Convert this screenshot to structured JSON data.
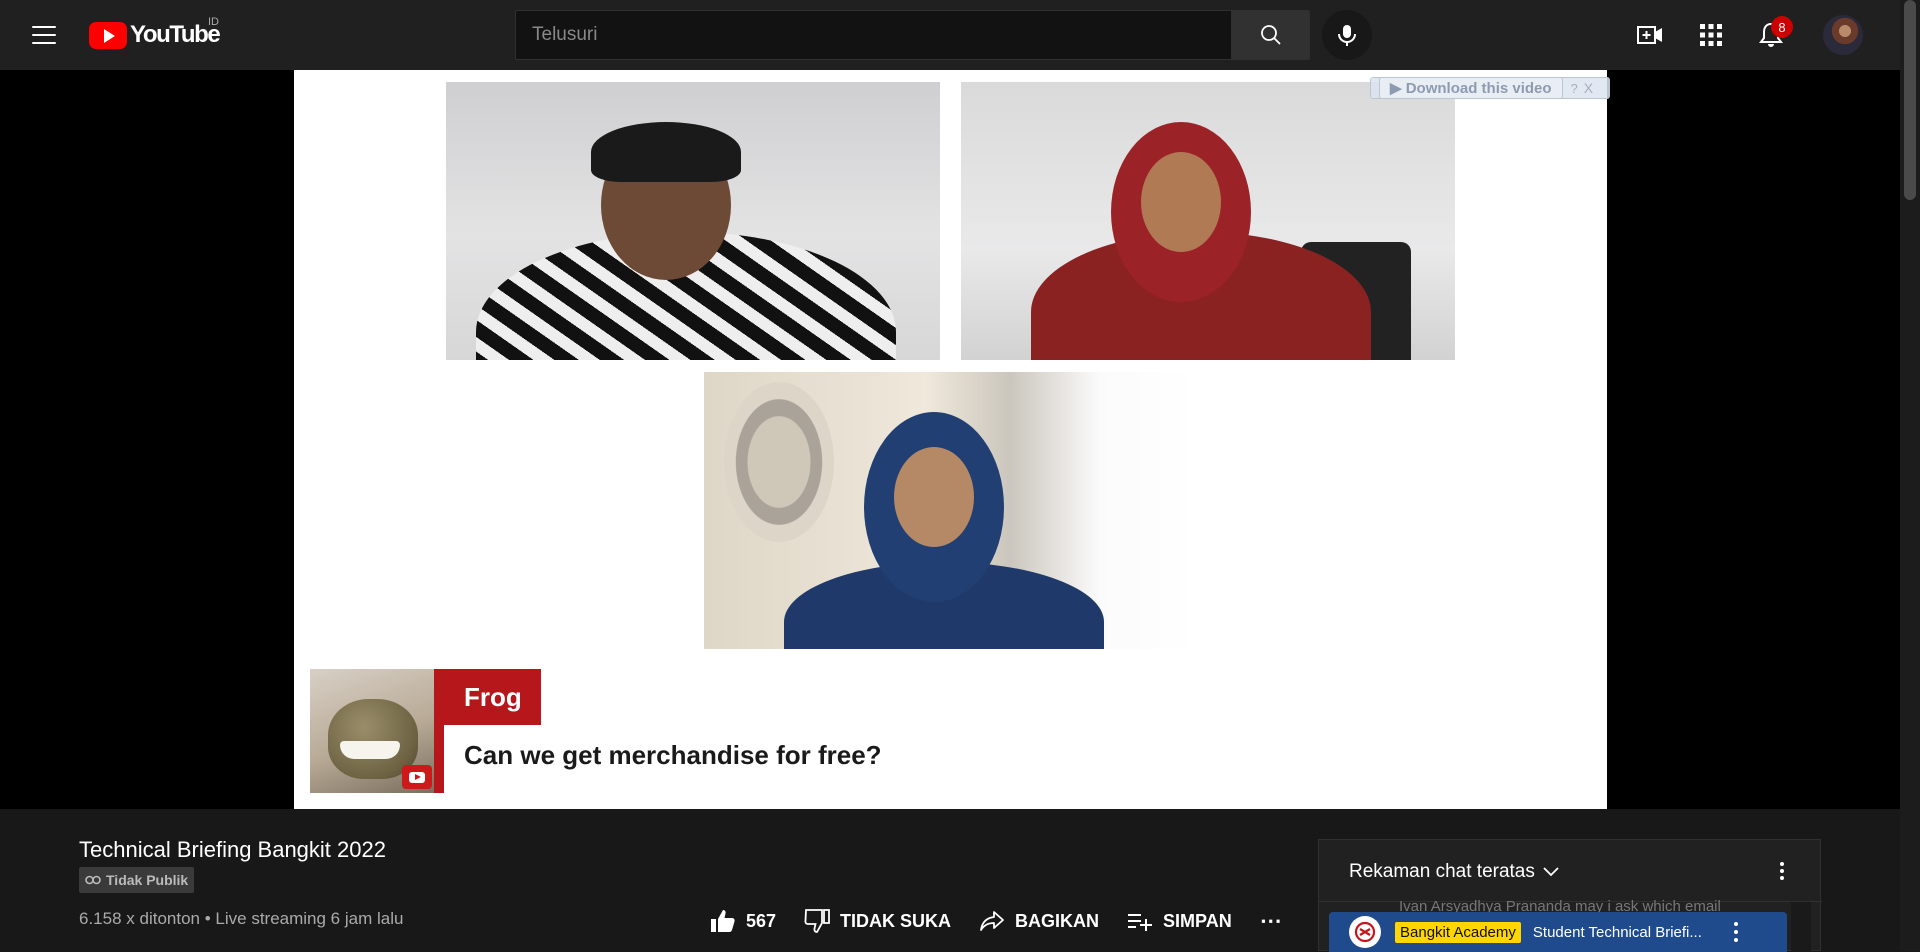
{
  "header": {
    "logo_text": "YouTube",
    "country_code": "ID",
    "search_placeholder": "Telusuri",
    "notification_count": "8",
    "icons": {
      "menu": "hamburger-menu-icon",
      "search": "search-icon",
      "mic": "microphone-icon",
      "create": "create-video-icon",
      "apps": "apps-grid-icon",
      "notifications": "bell-icon"
    }
  },
  "overlay": {
    "download_label": "Download this video",
    "help_label": "?",
    "close_label": "X"
  },
  "video_frame": {
    "participant_name": "Frog",
    "question": "Can we get merchandise for free?"
  },
  "video": {
    "title": "Technical Briefing Bangkit 2022",
    "privacy": "Tidak Publik",
    "views": "6.158 x ditonton",
    "separator": "•",
    "upload_info": "Live streaming 6 jam lalu"
  },
  "actions": {
    "like_count": "567",
    "dislike_label": "TIDAK SUKA",
    "share_label": "BAGIKAN",
    "save_label": "SIMPAN",
    "more_label": "⋯"
  },
  "chat": {
    "mode_label": "Rekaman chat teratas",
    "ghost_message": "Ivan Arsyadhya Prananda  may i ask which email",
    "pinned": {
      "author": "Bangkit Academy",
      "message": "Student Technical Briefi..."
    }
  },
  "colors": {
    "brand_red": "#ff0000",
    "masthead_bg": "#202020",
    "page_bg": "#181818",
    "name_tag_red": "#b5171a",
    "pinned_blue": "#1f4b8c",
    "author_badge_yellow": "#ffd600"
  }
}
